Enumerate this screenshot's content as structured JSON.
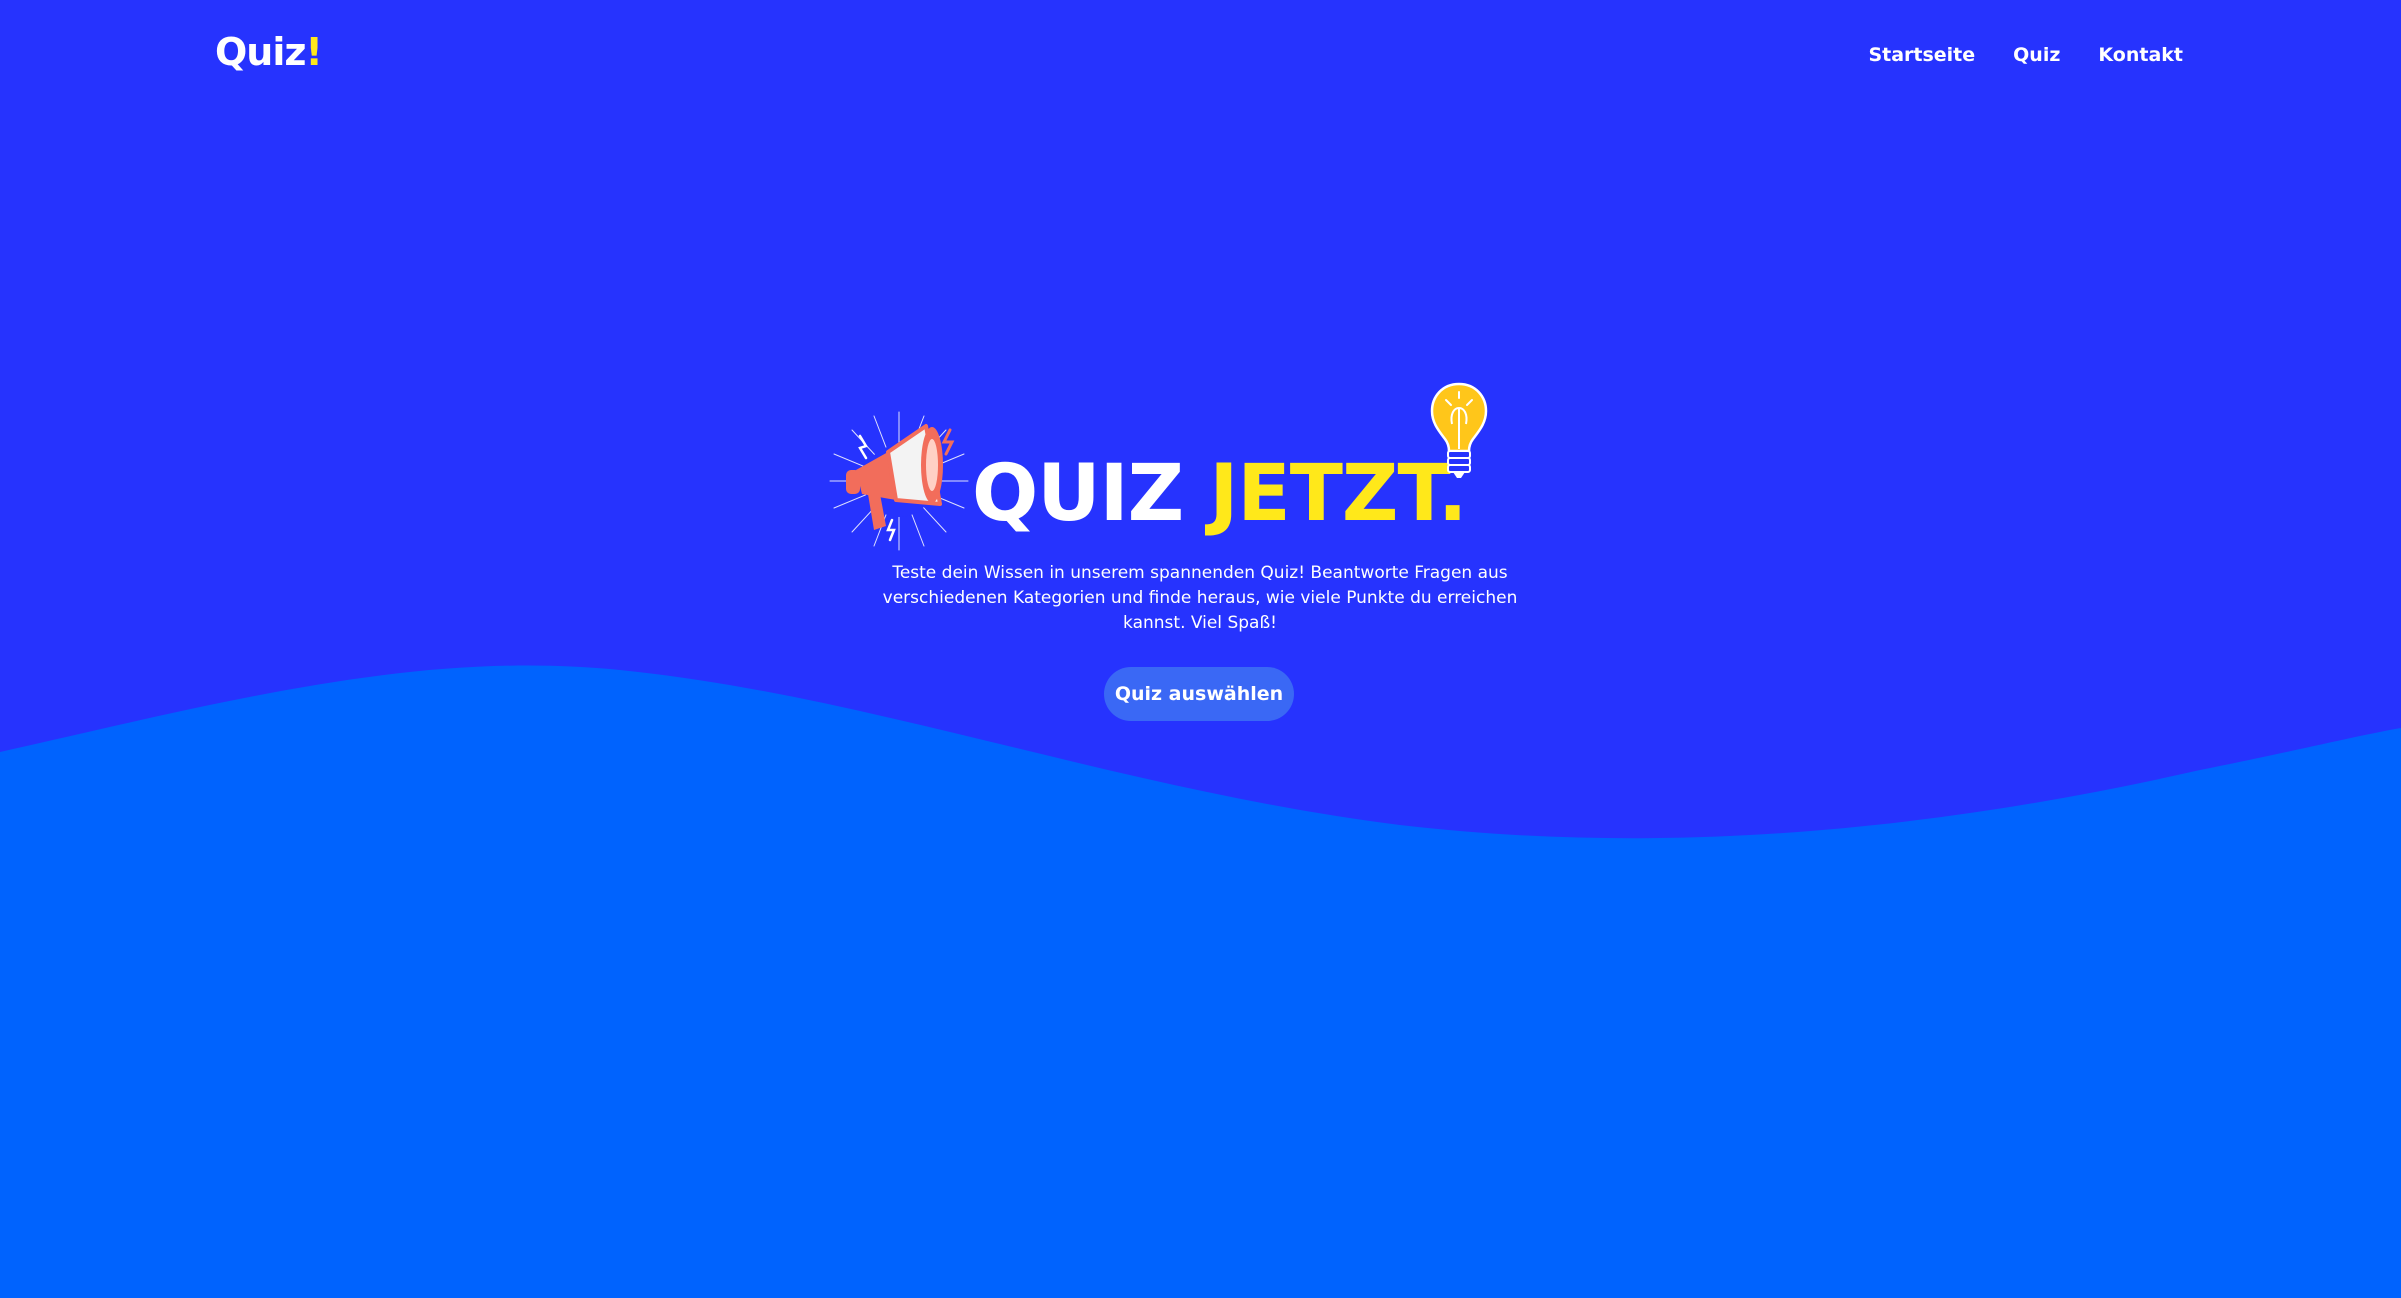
{
  "header": {
    "logo_main": "Quiz",
    "logo_accent": "!",
    "nav": [
      "Startseite",
      "Quiz",
      "Kontakt"
    ]
  },
  "hero": {
    "title_white": "QUIZ",
    "title_yellow": "JETZT.",
    "description": "Teste dein Wissen in unserem spannenden Quiz! Beantworte Fragen aus verschiedenen Kategorien und finde heraus, wie viele Punkte du erreichen kannst. Viel Spaß!",
    "button_label": "Quiz auswählen"
  },
  "icons": {
    "megaphone": "megaphone-icon",
    "bulb": "lightbulb-icon"
  },
  "colors": {
    "background_top": "#2633fe",
    "background_wave": "#0063fe",
    "accent_yellow": "#ffe81a",
    "button": "#3a68f5",
    "text": "#ffffff"
  }
}
